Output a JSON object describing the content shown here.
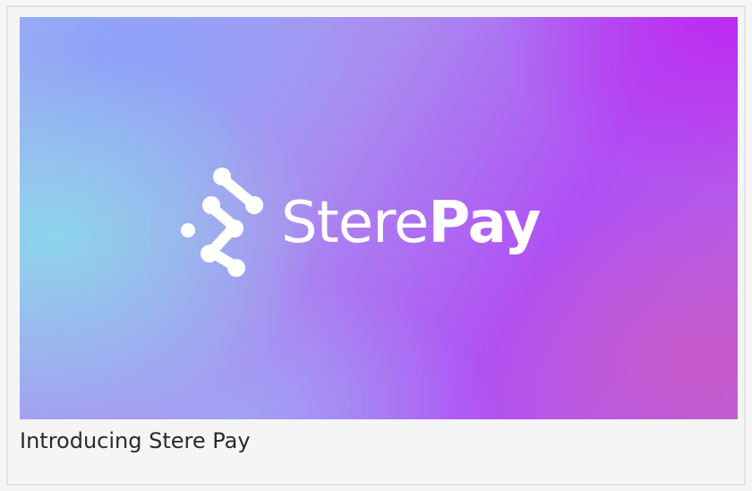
{
  "card": {
    "caption": "Introducing Stere Pay",
    "banner": {
      "brand_light": "Stere",
      "brand_bold": "Pay",
      "logo_icon": "stere-molecule-logo-icon"
    }
  },
  "colors": {
    "gradient_cyan": "#8cd7eb",
    "gradient_purple": "#be28f0",
    "gradient_magenta": "#c85ac8",
    "text_on_banner": "#ffffff",
    "caption_text": "#2a2a2a"
  }
}
